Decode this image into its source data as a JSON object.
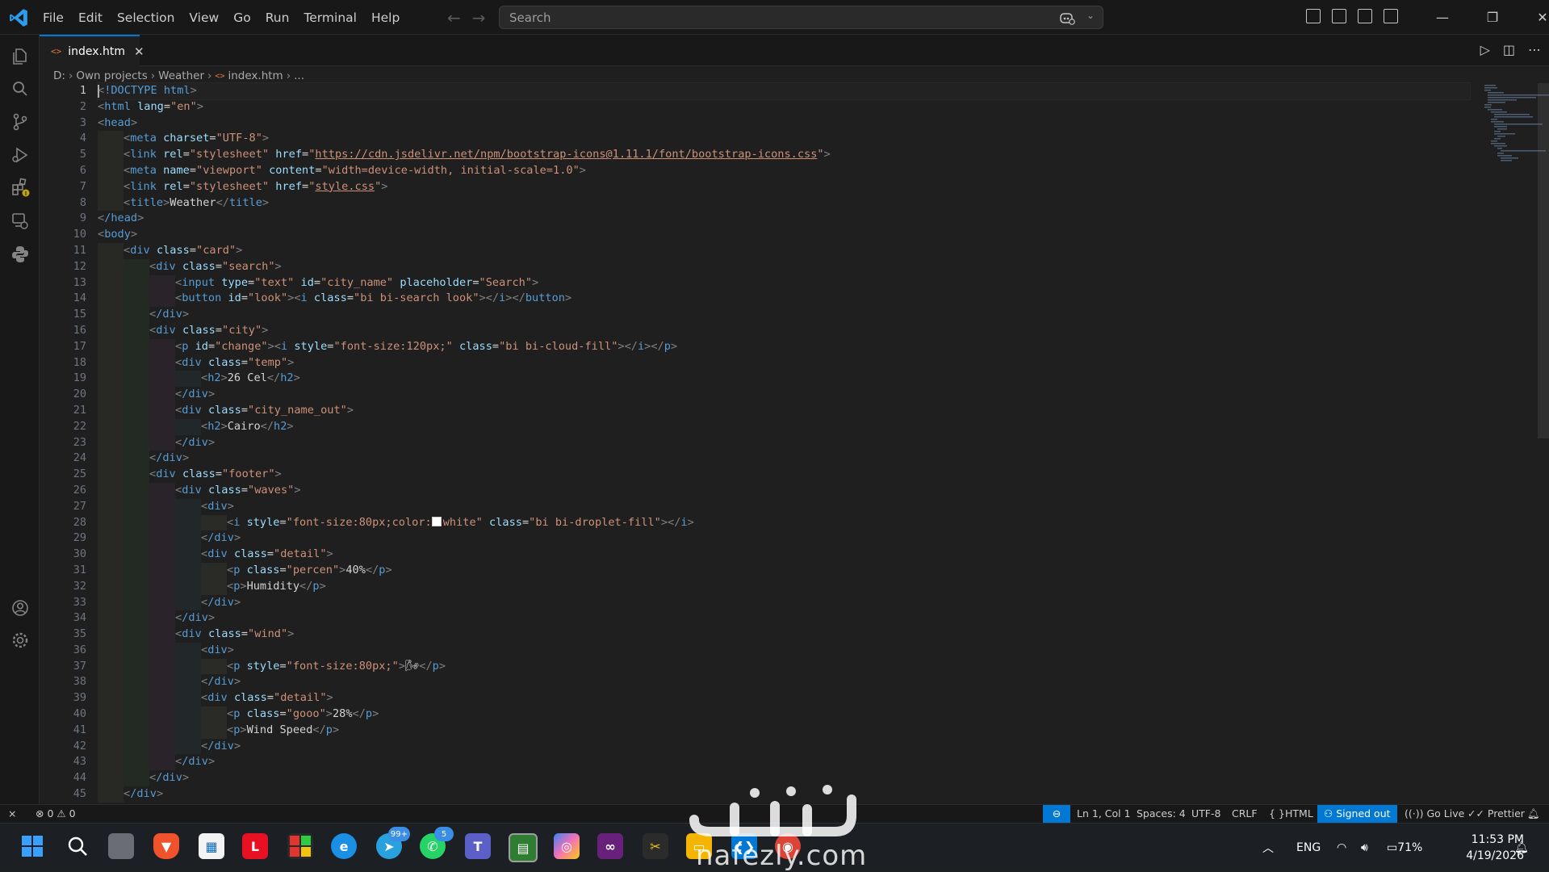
{
  "titlebar": {
    "menu": [
      "File",
      "Edit",
      "Selection",
      "View",
      "Go",
      "Run",
      "Terminal",
      "Help"
    ],
    "search_placeholder": "Search"
  },
  "tab": {
    "filename": "index.htm",
    "icon_text": "<>"
  },
  "breadcrumb": [
    "D:",
    "Own projects",
    "Weather",
    "index.htm",
    "..."
  ],
  "editor": {
    "line_numbers": [
      "1",
      "2",
      "3",
      "4",
      "5",
      "6",
      "7",
      "8",
      "9",
      "10",
      "11",
      "12",
      "13",
      "14",
      "15",
      "16",
      "17",
      "18",
      "19",
      "20",
      "21",
      "22",
      "23",
      "24",
      "25",
      "26",
      "27",
      "28",
      "29",
      "30",
      "31",
      "32",
      "33",
      "34",
      "35",
      "36",
      "37",
      "38",
      "39",
      "40",
      "41",
      "42",
      "43",
      "44",
      "45"
    ],
    "cursor_line": 1,
    "code": {
      "l1_tag": "!DOCTYPE html",
      "l2_tag": "html",
      "l2_attr": "lang",
      "l2_val": "\"en\"",
      "l3_tag": "head",
      "l4_tag": "meta",
      "l4_attr": "charset",
      "l4_val": "\"UTF-8\"",
      "l5_tag": "link",
      "l5_attr1": "rel",
      "l5_val1": "\"stylesheet\"",
      "l5_attr2": "href",
      "l5_url": "https://cdn.jsdelivr.net/npm/bootstrap-icons@1.11.1/font/bootstrap-icons.css",
      "l6_tag": "meta",
      "l6_attr1": "name",
      "l6_val1": "\"viewport\"",
      "l6_attr2": "content",
      "l6_val2": "\"width=device-width, initial-scale=1.0\"",
      "l7_tag": "link",
      "l7_attr1": "rel",
      "l7_val1": "\"stylesheet\"",
      "l7_attr2": "href",
      "l7_url": "style.css",
      "l8_tag": "title",
      "l8_text": "Weather",
      "l9_tag": "/head",
      "l10_tag": "body",
      "l11_tag": "div",
      "l11_attr": "class",
      "l11_val": "\"card\"",
      "l12_tag": "div",
      "l12_attr": "class",
      "l12_val": "\"search\"",
      "l13_tag": "input",
      "l13_attr1": "type",
      "l13_val1": "\"text\"",
      "l13_attr2": "id",
      "l13_val2": "\"city_name\"",
      "l13_attr3": "placeholder",
      "l13_val3": "\"Search\"",
      "l14_tag": "button",
      "l14_attr1": "id",
      "l14_val1": "\"look\"",
      "l14_tag2": "i",
      "l14_attr2": "class",
      "l14_val2": "\"bi bi-search look\"",
      "l15_tag": "/div",
      "l16_tag": "div",
      "l16_attr": "class",
      "l16_val": "\"city\"",
      "l17_tag": "p",
      "l17_attr1": "id",
      "l17_val1": "\"change\"",
      "l17_tag2": "i",
      "l17_attr2": "style",
      "l17_val2": "\"font-size:120px;\"",
      "l17_attr3": "class",
      "l17_val3": "\"bi bi-cloud-fill\"",
      "l18_tag": "div",
      "l18_attr": "class",
      "l18_val": "\"temp\"",
      "l19_tag": "h2",
      "l19_text": "26 Cel",
      "l20_tag": "/div",
      "l21_tag": "div",
      "l21_attr": "class",
      "l21_val": "\"city_name_out\"",
      "l22_tag": "h2",
      "l22_text": "Cairo",
      "l23_tag": "/div",
      "l24_tag": "/div",
      "l25_tag": "div",
      "l25_attr": "class",
      "l25_val": "\"footer\"",
      "l26_tag": "div",
      "l26_attr": "class",
      "l26_val": "\"waves\"",
      "l27_tag": "div",
      "l28_tag": "i",
      "l28_attr1": "style",
      "l28_val1a": "\"font-size:80px;color:",
      "l28_val1b": "white\"",
      "l28_attr2": "class",
      "l28_val2": "\"bi bi-droplet-fill\"",
      "l29_tag": "/div",
      "l30_tag": "div",
      "l30_attr": "class",
      "l30_val": "\"detail\"",
      "l31_tag": "p",
      "l31_attr": "class",
      "l31_val": "\"percen\"",
      "l31_text": "40%",
      "l32_tag": "p",
      "l32_text": "Humidity",
      "l33_tag": "/div",
      "l34_tag": "/div",
      "l35_tag": "div",
      "l35_attr": "class",
      "l35_val": "\"wind\"",
      "l36_tag": "div",
      "l37_tag": "p",
      "l37_attr": "style",
      "l37_val": "\"font-size:80px;\"",
      "l37_text": "🌬",
      "l38_tag": "/div",
      "l39_tag": "div",
      "l39_attr": "class",
      "l39_val": "\"detail\"",
      "l40_tag": "p",
      "l40_attr": "class",
      "l40_val": "\"gooo\"",
      "l40_text": "28%",
      "l41_tag": "p",
      "l41_text": "Wind Speed",
      "l42_tag": "/div",
      "l43_tag": "/div",
      "l44_tag": "/div",
      "l45_tag": "/div"
    }
  },
  "statusbar": {
    "errors": "0",
    "warnings": "0",
    "position": "Ln 1, Col 1",
    "spaces": "Spaces: 4",
    "encoding": "UTF-8",
    "eol": "CRLF",
    "language": "HTML",
    "account": "Signed out",
    "go_live": "Go Live",
    "prettier": "Prettier"
  },
  "taskbar": {
    "telegram_badge": "99+",
    "whatsapp_badge": "5",
    "language": "ENG",
    "battery": "71%",
    "time": "11:53 PM",
    "date": "4/19/2026"
  },
  "watermark": {
    "arabic": "نفذلي",
    "latin": "nafezly.com"
  },
  "colors": {
    "accent": "#0078d4",
    "tag": "#569cd6",
    "attr": "#9cdcfe",
    "string": "#ce9178",
    "bracket": "#808080"
  }
}
